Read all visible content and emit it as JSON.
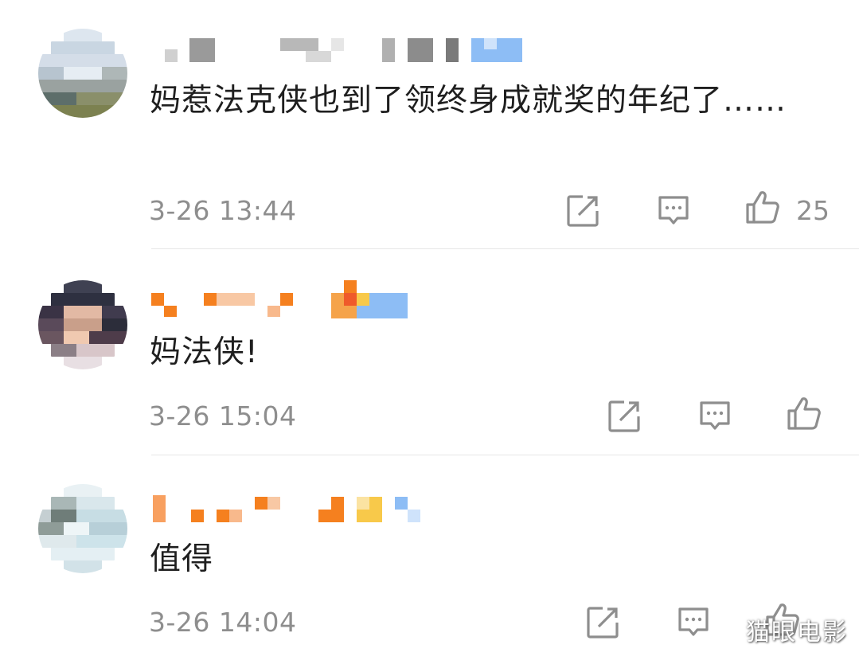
{
  "comments": [
    {
      "text": "妈惹法克侠也到了领终身成就奖的年纪了……",
      "time": "3-26 13:44",
      "likes": "25",
      "icons": [
        "share-icon",
        "reply-icon",
        "like-icon"
      ]
    },
    {
      "text": "妈法侠!",
      "time": "3-26 15:04",
      "likes": "",
      "icons": [
        "share-icon",
        "reply-icon",
        "like-icon"
      ]
    },
    {
      "text": "值得",
      "time": "3-26 14:04",
      "likes": "",
      "icons": [
        "share-icon",
        "reply-icon",
        "like-icon"
      ]
    }
  ],
  "watermark": "猫眼电影",
  "colors": {
    "text": "#1f1f1f",
    "meta": "#8e8e8e",
    "icon": "#8e8e8e",
    "divider": "#e6e6e6",
    "username_orange": "#f5801f",
    "username_blue": "#8dbdf5"
  }
}
